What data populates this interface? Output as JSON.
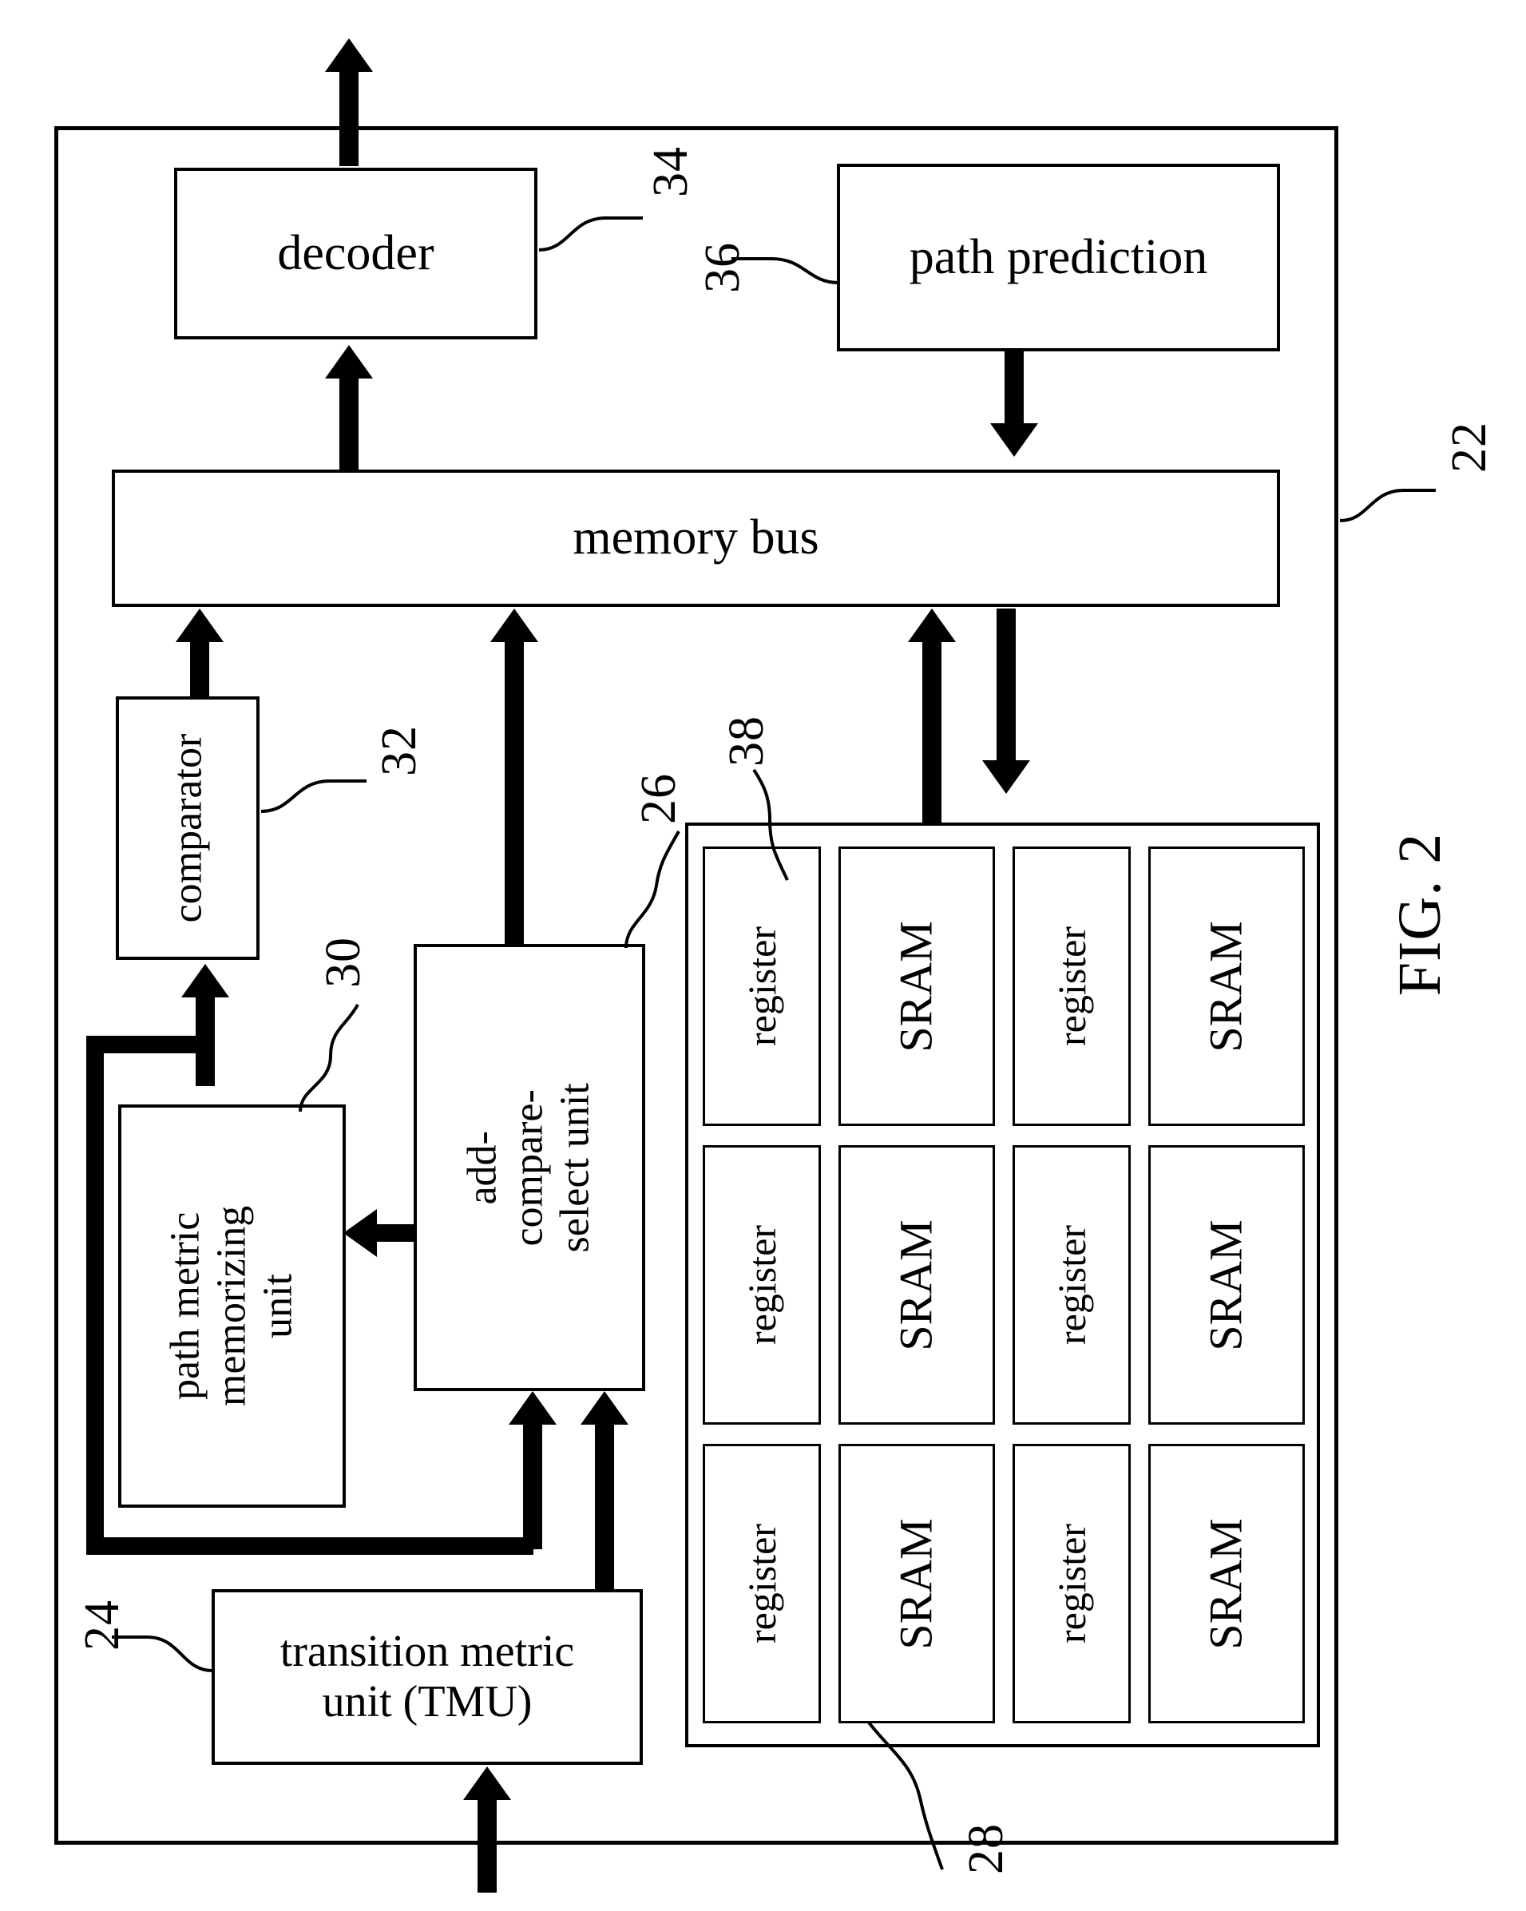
{
  "figure": {
    "caption": "FIG. 2",
    "outer_ref": "22"
  },
  "blocks": {
    "decoder": {
      "label": "decoder",
      "ref": "34"
    },
    "path_prediction": {
      "label": "path prediction",
      "ref": "36"
    },
    "memory_bus": {
      "label": "memory bus"
    },
    "comparator": {
      "label": "comparator",
      "ref": "32"
    },
    "path_metric": {
      "label": "path metric\nmemorizing\nunit",
      "ref": "30"
    },
    "acs": {
      "label": "add-compare-\nselect unit",
      "ref": "26"
    },
    "tmu": {
      "label": "transition metric\nunit (TMU)",
      "ref": "24"
    },
    "memory_array": {
      "ref": "28",
      "cell_ref": "38"
    }
  },
  "memory_cells": {
    "register_label": "register",
    "sram_label": "SRAM",
    "columns": [
      {
        "cells": [
          "register",
          "SRAM",
          "register",
          "SRAM"
        ]
      },
      {
        "cells": [
          "register",
          "SRAM",
          "register",
          "SRAM"
        ]
      },
      {
        "cells": [
          "register",
          "SRAM",
          "register",
          "SRAM"
        ]
      }
    ]
  },
  "colors": {
    "ink": "#000000",
    "paper": "#ffffff"
  }
}
